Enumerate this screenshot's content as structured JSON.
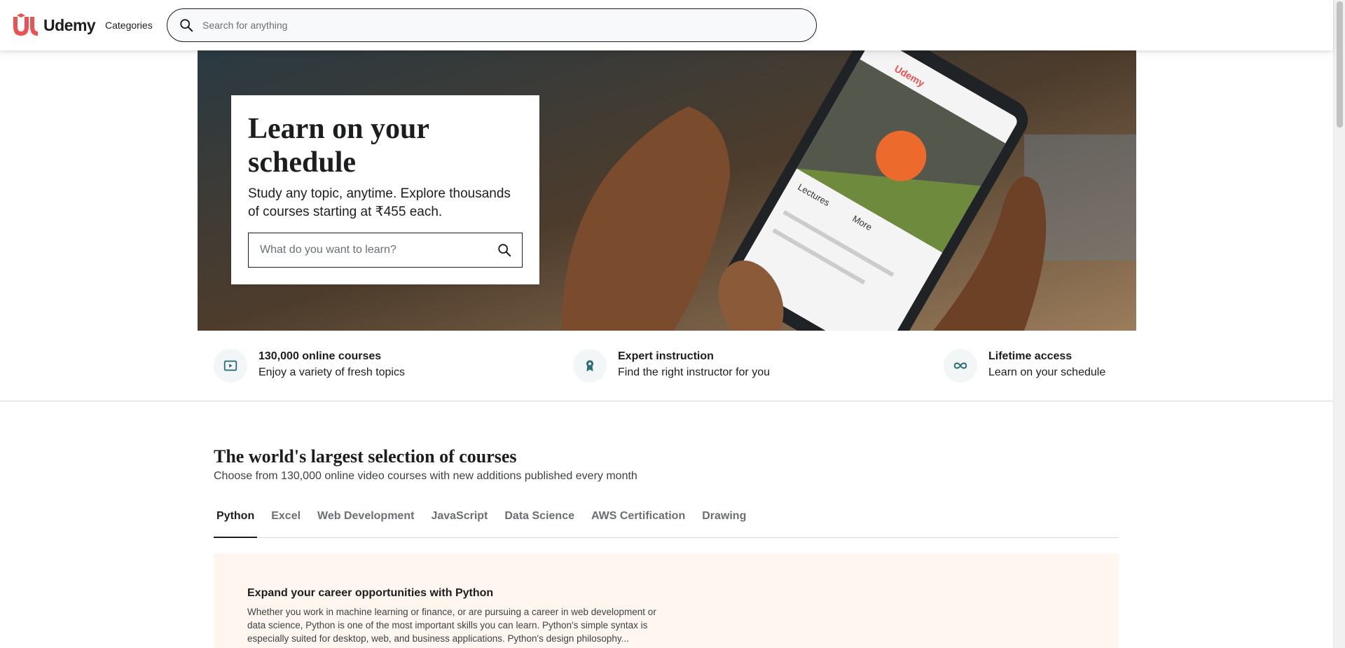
{
  "header": {
    "logo_text": "Udemy",
    "categories_label": "Categories",
    "search_placeholder": "Search for anything"
  },
  "hero": {
    "title": "Learn on your schedule",
    "subtitle": "Study any topic, anytime. Explore thousands of courses starting at ₹455 each.",
    "search_placeholder": "What do you want to learn?",
    "phone": {
      "brand": "Udemy",
      "tab_lectures": "Lectures",
      "tab_more": "More"
    }
  },
  "features": [
    {
      "icon": "play-video-icon",
      "title": "130,000 online courses",
      "desc": "Enjoy a variety of fresh topics"
    },
    {
      "icon": "ribbon-award-icon",
      "title": "Expert instruction",
      "desc": "Find the right instructor for you"
    },
    {
      "icon": "infinity-icon",
      "title": "Lifetime access",
      "desc": "Learn on your schedule"
    }
  ],
  "courses_section": {
    "title": "The world's largest selection of courses",
    "subtitle": "Choose from 130,000 online video courses with new additions published every month",
    "tabs": [
      "Python",
      "Excel",
      "Web Development",
      "JavaScript",
      "Data Science",
      "AWS Certification",
      "Drawing"
    ],
    "active_tab": "Python",
    "panel": {
      "title": "Expand your career opportunities with Python",
      "body": "Whether you work in machine learning or finance, or are pursuing a career in web development or data science, Python is one of the most important skills you can learn. Python's simple syntax is especially suited for desktop, web, and business applications. Python's design philosophy..."
    }
  },
  "colors": {
    "brand": "#a435f0",
    "logo_red": "#ec5252",
    "text": "#1c1d1f",
    "panel_bg": "#fff6f0"
  }
}
